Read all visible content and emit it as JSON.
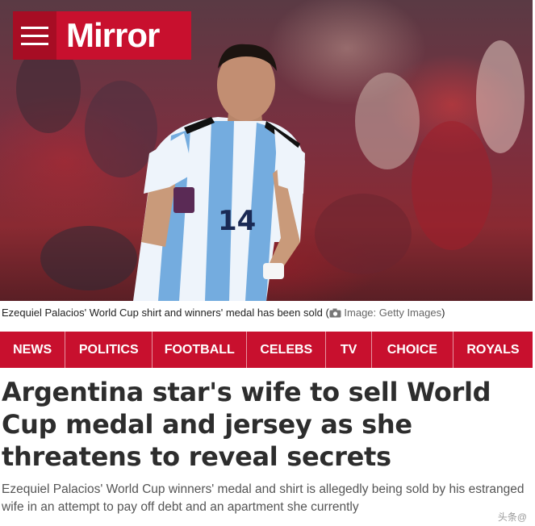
{
  "header": {
    "logo": "Mirror",
    "brand_color": "#c8102e"
  },
  "hero": {
    "player_number": "14"
  },
  "caption": {
    "text": "Ezequiel Palacios' World Cup shirt and winners' medal has been sold",
    "credit": "Image: Getty Images"
  },
  "nav": {
    "items": [
      "NEWS",
      "POLITICS",
      "FOOTBALL",
      "CELEBS",
      "TV",
      "CHOICE",
      "ROYALS"
    ]
  },
  "article": {
    "headline": "Argentina star's wife to sell World Cup medal and jersey as she threatens to reveal secrets",
    "standfirst": "Ezequiel Palacios' World Cup winners' medal and shirt is allegedly being sold by his estranged wife in an attempt to pay off debt and an apartment she currently"
  },
  "watermark": "头条@"
}
